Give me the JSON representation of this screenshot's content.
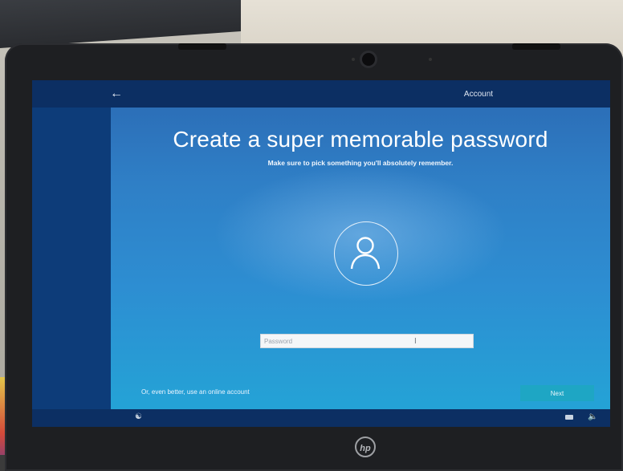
{
  "header": {
    "tab_account": "Account"
  },
  "main": {
    "title": "Create a super memorable password",
    "subtitle": "Make sure to pick something you'll absolutely remember.",
    "password": {
      "value": "",
      "placeholder": "Password"
    },
    "online_account_link": "Or, even better, use an online account",
    "next_label": "Next"
  },
  "brand": {
    "logo_text": "hp"
  },
  "icons": {
    "back": "back-arrow-icon",
    "user": "user-icon",
    "ease_of_access": "ease-of-access-icon",
    "keyboard": "keyboard-icon",
    "volume": "volume-icon"
  },
  "colors": {
    "accent": "#1ea6c4",
    "screen_top": "#0c2f63"
  }
}
